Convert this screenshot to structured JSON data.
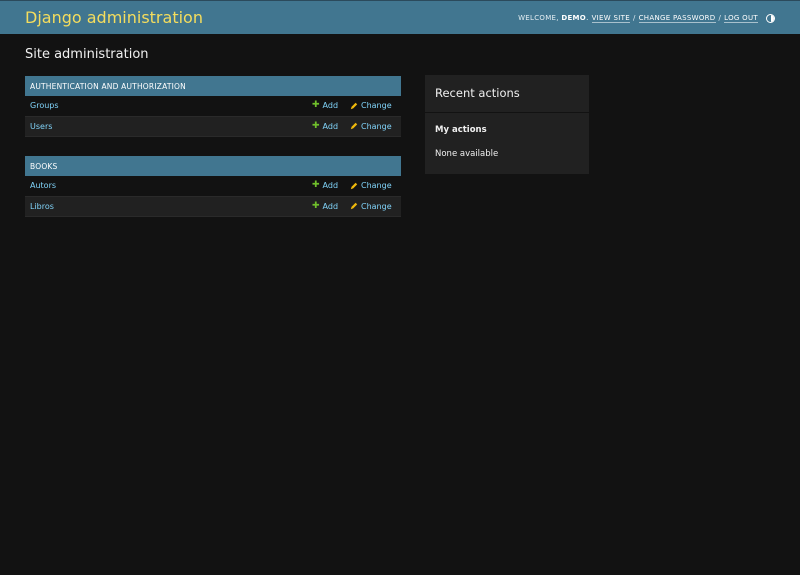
{
  "header": {
    "site_name": "Django administration",
    "welcome": "Welcome,",
    "username": "demo",
    "view_site": "View site",
    "change_password": "Change password",
    "log_out": "Log out",
    "theme_toggle_icon": "contrast-half-circle-icon"
  },
  "page": {
    "title": "Site administration"
  },
  "modules": [
    {
      "caption": "Authentication and Authorization",
      "models": [
        {
          "name": "Groups",
          "add": "Add",
          "change": "Change"
        },
        {
          "name": "Users",
          "add": "Add",
          "change": "Change"
        }
      ]
    },
    {
      "caption": "Books",
      "models": [
        {
          "name": "Autors",
          "add": "Add",
          "change": "Change"
        },
        {
          "name": "Libros",
          "add": "Add",
          "change": "Change"
        }
      ]
    }
  ],
  "recent_actions": {
    "title": "Recent actions",
    "subtitle": "My actions",
    "empty": "None available"
  },
  "colors": {
    "header_bg": "#417690",
    "site_name": "#f5dd5d",
    "link": "#81d4fa",
    "add_icon": "#70bf2b",
    "change_icon": "#efb80b",
    "body_bg": "#121212"
  }
}
